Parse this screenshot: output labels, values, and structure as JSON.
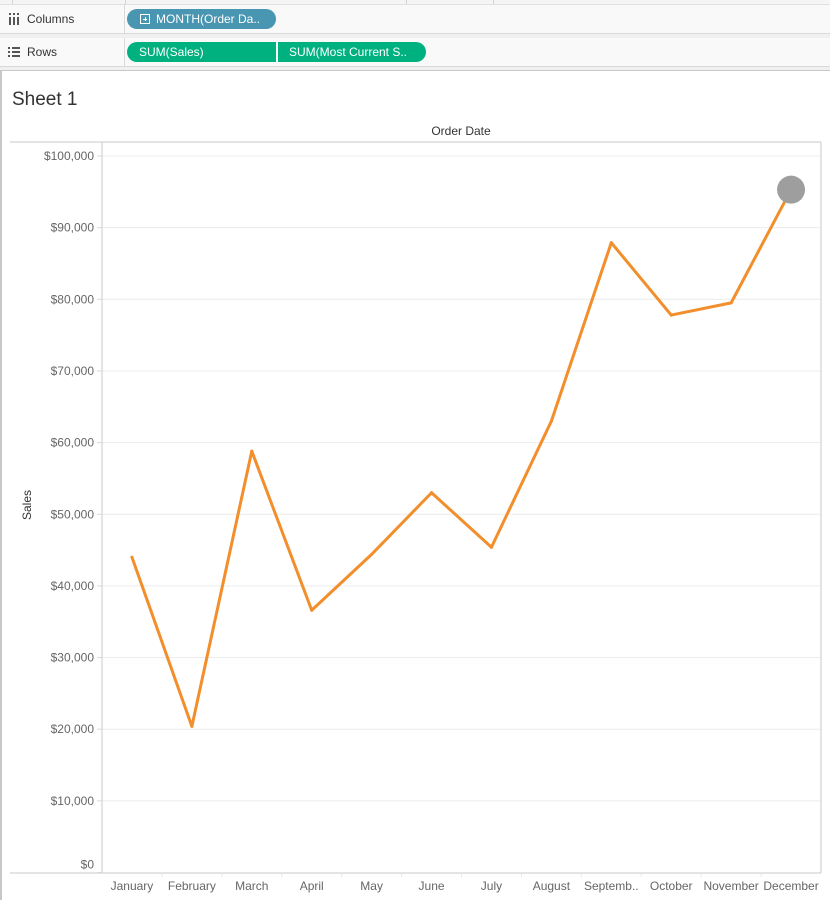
{
  "shelves": {
    "columns": {
      "label": "Columns",
      "icon": "columns-icon",
      "pills": [
        {
          "label": "MONTH(Order Da..",
          "color": "#4996b2",
          "icon": "expand-plus-icon"
        }
      ]
    },
    "rows": {
      "label": "Rows",
      "icon": "rows-icon",
      "pills": [
        {
          "label": "SUM(Sales)",
          "color": "#00b180"
        },
        {
          "label": "SUM(Most Current S..",
          "color": "#00b180"
        }
      ]
    }
  },
  "sheet": {
    "title": "Sheet 1"
  },
  "chart_data": {
    "type": "line",
    "title": "Sheet 1",
    "column_header": "Order Date",
    "xlabel": "",
    "ylabel": "Sales",
    "categories": [
      "January",
      "February",
      "March",
      "April",
      "May",
      "June",
      "July",
      "August",
      "Septemb..",
      "October",
      "November",
      "December"
    ],
    "series": [
      {
        "name": "SUM(Sales)",
        "color": "#f28e2b",
        "values": [
          44000,
          20400,
          58800,
          36600,
          44400,
          53000,
          45400,
          63000,
          87900,
          77800,
          79500,
          95300
        ]
      },
      {
        "name": "SUM(Most Current Sales)",
        "color": "#9e9e9e",
        "mark": "circle",
        "values": [
          null,
          null,
          null,
          null,
          null,
          null,
          null,
          null,
          null,
          null,
          null,
          95300
        ]
      }
    ],
    "ylim": [
      0,
      100000
    ],
    "yticks": [
      0,
      10000,
      20000,
      30000,
      40000,
      50000,
      60000,
      70000,
      80000,
      90000,
      100000
    ],
    "ytick_labels": [
      "$0",
      "$10,000",
      "$20,000",
      "$30,000",
      "$40,000",
      "$50,000",
      "$60,000",
      "$70,000",
      "$80,000",
      "$90,000",
      "$100,000"
    ],
    "grid": true,
    "legend": "none"
  }
}
